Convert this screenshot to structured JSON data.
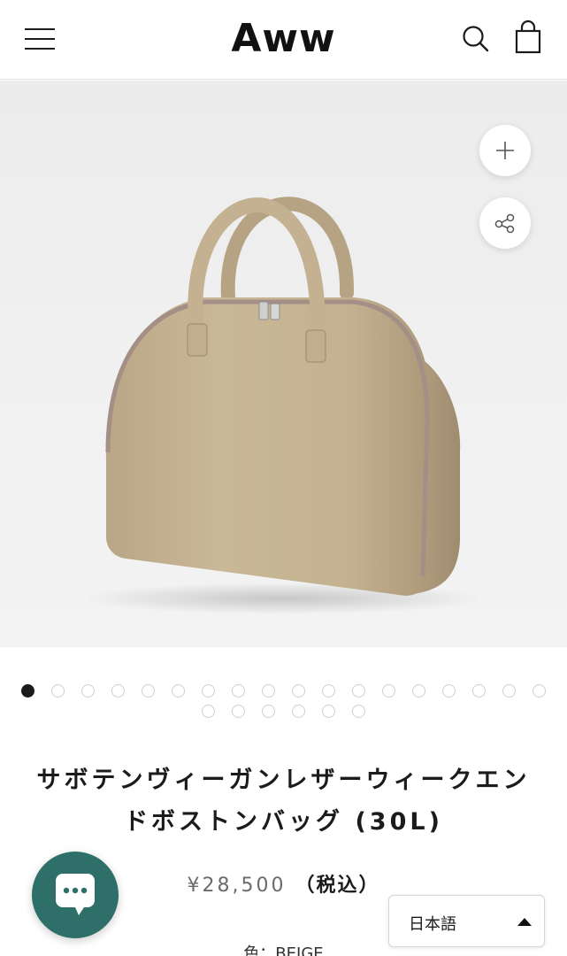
{
  "header": {
    "logo": "Aww",
    "menu_icon": "hamburger-menu-icon",
    "search_icon": "search-icon",
    "cart_icon": "shopping-bag-icon"
  },
  "gallery": {
    "zoom_icon": "plus-icon",
    "share_icon": "share-icon",
    "slide_count": 24,
    "active_index": 0
  },
  "product": {
    "title": "サボテンヴィーガンレザーウィークエンドボストンバッグ (30L)",
    "price": "¥28,500",
    "tax_label": "（税込）",
    "variant_text": "色：BEIGE"
  },
  "chat": {
    "icon": "chat-bubble-icon"
  },
  "language": {
    "selected": "日本語"
  },
  "colors": {
    "chat_bg": "#2e7069",
    "bag": "#c4b396"
  }
}
